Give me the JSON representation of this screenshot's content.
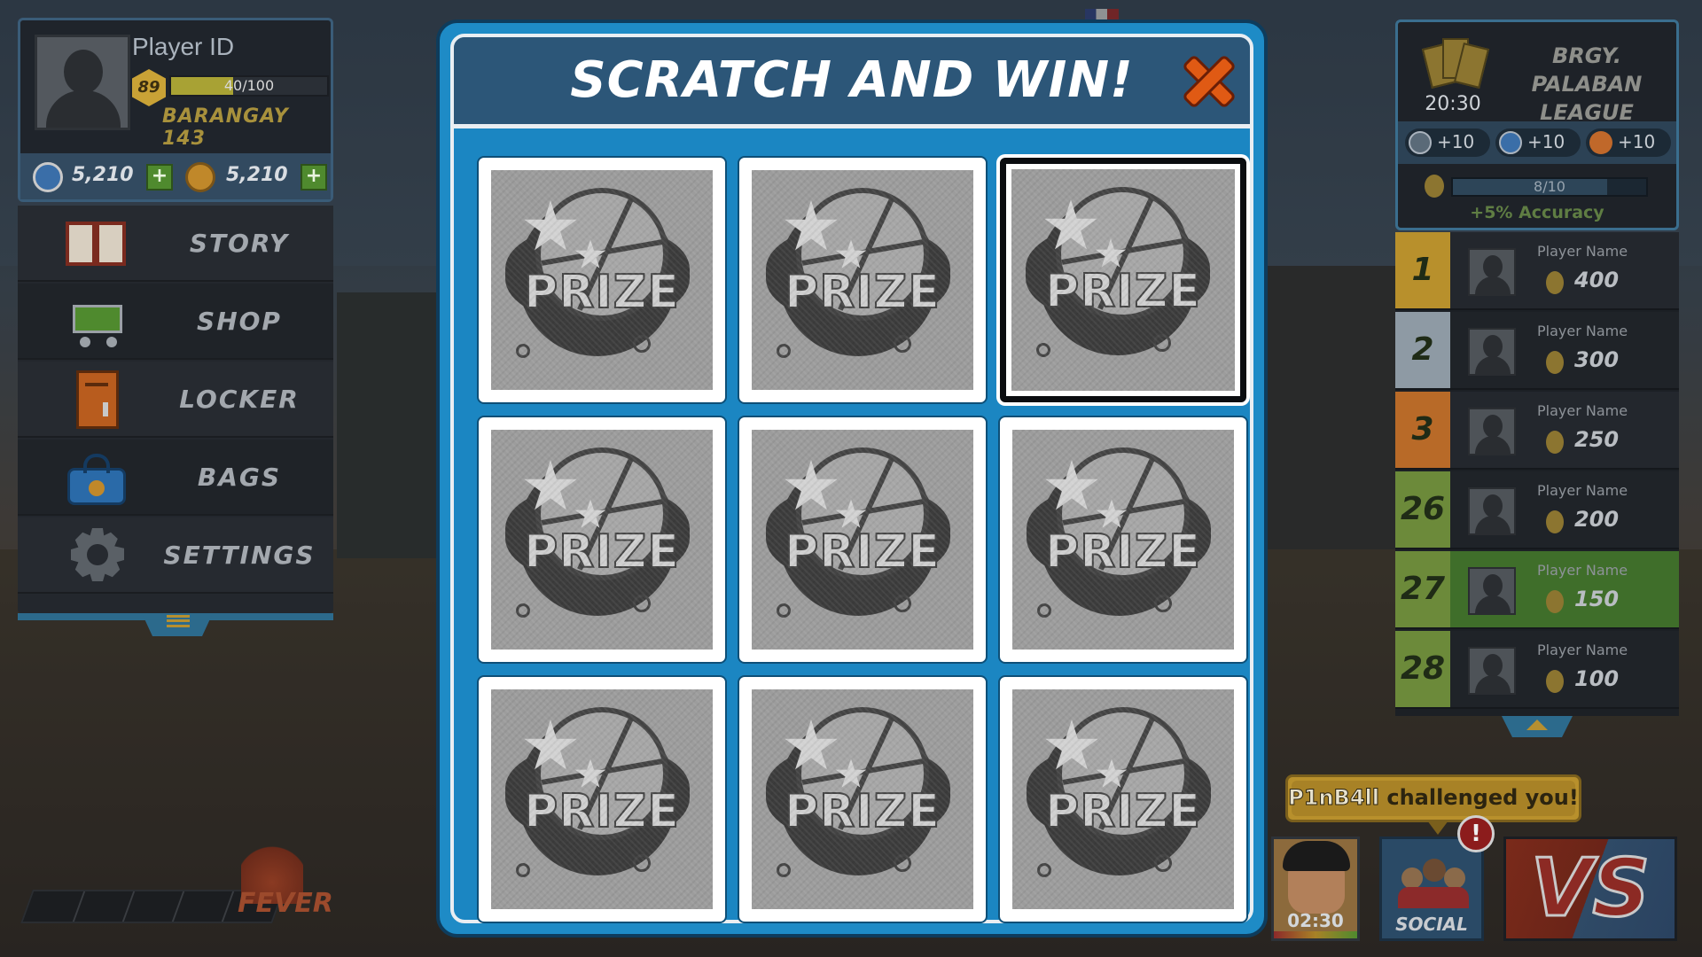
{
  "profile": {
    "player_id": "Player ID",
    "level": "89",
    "xp_text": "40/100",
    "xp_progress": 0.4,
    "barangay": "BARANGAY 143",
    "currency_1": "5,210",
    "currency_2": "5,210",
    "plus": "+"
  },
  "menu": {
    "items": [
      {
        "label": "STORY",
        "icon": "book-icon"
      },
      {
        "label": "SHOP",
        "icon": "cart-icon"
      },
      {
        "label": "LOCKER",
        "icon": "locker-icon"
      },
      {
        "label": "BAGS",
        "icon": "bag-icon"
      },
      {
        "label": "SETTINGS",
        "icon": "gear-icon"
      }
    ]
  },
  "fever": {
    "label": "FEVER"
  },
  "modal": {
    "title": "SCRATCH AND WIN!",
    "cards": [
      {
        "label": "PRIZE",
        "selected": false
      },
      {
        "label": "PRIZE",
        "selected": false
      },
      {
        "label": "PRIZE",
        "selected": true
      },
      {
        "label": "PRIZE",
        "selected": false
      },
      {
        "label": "PRIZE",
        "selected": false
      },
      {
        "label": "PRIZE",
        "selected": false
      },
      {
        "label": "PRIZE",
        "selected": false
      },
      {
        "label": "PRIZE",
        "selected": false
      },
      {
        "label": "PRIZE",
        "selected": false
      }
    ]
  },
  "league": {
    "name_line1": "BRGY. PALABAN",
    "name_line2": "LEAGUE",
    "time": "20:30",
    "bonuses": [
      "+10",
      "+10",
      "+10"
    ],
    "accuracy_progress_text": "8/10",
    "accuracy_progress": 0.8,
    "accuracy_label": "+5% Accuracy"
  },
  "leaderboard": [
    {
      "rank": "1",
      "name": "Player Name",
      "score": "400",
      "color": "#b8902c"
    },
    {
      "rank": "2",
      "name": "Player Name",
      "score": "300",
      "color": "#8e9aa4"
    },
    {
      "rank": "3",
      "name": "Player Name",
      "score": "250",
      "color": "#b86a28"
    },
    {
      "rank": "26",
      "name": "Player Name",
      "score": "200",
      "color": "#6c8a3a"
    },
    {
      "rank": "27",
      "name": "Player Name",
      "score": "150",
      "color": "#6c8a3a",
      "highlight": "#3f6e2a"
    },
    {
      "rank": "28",
      "name": "Player Name",
      "score": "100",
      "color": "#6c8a3a"
    }
  ],
  "challenge": {
    "text_name": "P1nB4ll",
    "text_rest": " challenged you!"
  },
  "timer": {
    "value": "02:30"
  },
  "social": {
    "label": "SOCIAL",
    "alert": "!"
  },
  "vs": {
    "label": "VS"
  }
}
